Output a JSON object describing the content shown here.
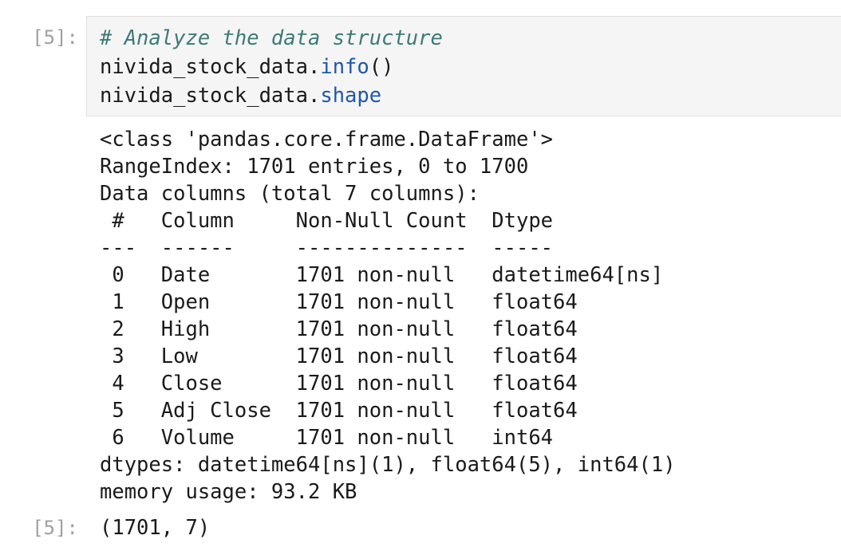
{
  "input_prompt": "[5]:",
  "output_prompt": "[5]:",
  "code": {
    "comment": "# Analyze the data structure",
    "line2_obj": "nivida_stock_data.",
    "line2_attr": "info",
    "line2_tail": "()",
    "line3_obj": "nivida_stock_data.",
    "line3_attr": "shape"
  },
  "stdout_lines": [
    "<class 'pandas.core.frame.DataFrame'>",
    "RangeIndex: 1701 entries, 0 to 1700",
    "Data columns (total 7 columns):",
    " #   Column     Non-Null Count  Dtype         ",
    "---  ------     --------------  -----         ",
    " 0   Date       1701 non-null   datetime64[ns]",
    " 1   Open       1701 non-null   float64       ",
    " 2   High       1701 non-null   float64       ",
    " 3   Low        1701 non-null   float64       ",
    " 4   Close      1701 non-null   float64       ",
    " 5   Adj Close  1701 non-null   float64       ",
    " 6   Volume     1701 non-null   int64         ",
    "dtypes: datetime64[ns](1), float64(5), int64(1)",
    "memory usage: 93.2 KB"
  ],
  "result": "(1701, 7)"
}
